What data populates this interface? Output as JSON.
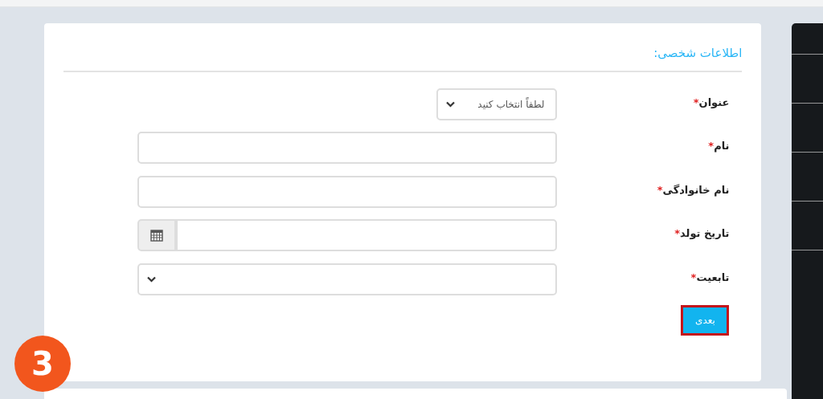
{
  "section_title": "اطلاعات شخصی:",
  "fields": [
    {
      "label": "عنوان",
      "required_mark": "*",
      "kind": "select",
      "value": "لطفاً انتخاب کنید",
      "wide": false
    },
    {
      "label": "نام",
      "required_mark": "*",
      "kind": "text",
      "wide": true
    },
    {
      "label": "نام خانوادگی",
      "required_mark": "*",
      "kind": "text",
      "wide": true
    },
    {
      "label": "تاریخ تولد",
      "required_mark": "*",
      "kind": "date",
      "wide": true
    },
    {
      "label": "تابعیت",
      "required_mark": "*",
      "kind": "select",
      "wide": true
    }
  ],
  "next_button": {
    "label": "بعدی",
    "highlighted": true
  },
  "step_badge": "3"
}
